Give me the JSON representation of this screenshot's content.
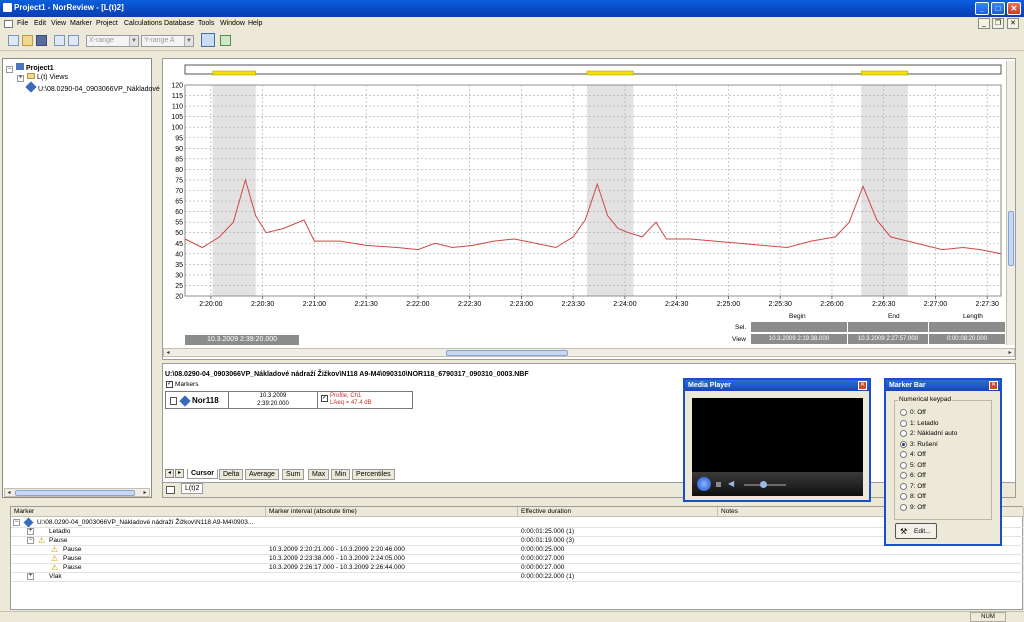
{
  "window": {
    "title": "Project1 - NorReview - [L(t)2]",
    "minimize": "_",
    "maximize": "□",
    "close": "✕",
    "mdi_minimize": "_",
    "mdi_restore": "❐",
    "mdi_close": "✕"
  },
  "menu": [
    "File",
    "Edit",
    "View",
    "Marker",
    "Project",
    "Calculations",
    "Database",
    "Tools",
    "Window",
    "Help"
  ],
  "toolbar": {
    "xrange_placeholder": "X-range",
    "yrange_placeholder": "Y-range A"
  },
  "tree": {
    "root": "Project1",
    "child1": "L(t) Views",
    "child2": "U:\\08.0290-04_0903066VP_Nákladové"
  },
  "chart_data": {
    "type": "line",
    "series": [
      {
        "name": "Profile, Ch1",
        "color": "#d04848",
        "values": []
      }
    ],
    "x_ticks": [
      "2:20:00",
      "2:20:30",
      "2:21:00",
      "2:21:30",
      "2:22:00",
      "2:22:30",
      "2:23:00",
      "2:23:30",
      "2:24:00",
      "2:24:30",
      "2:25:00",
      "2:25:30",
      "2:26:00",
      "2:26:30",
      "2:27:00",
      "2:27:30"
    ],
    "y_ticks": [
      120,
      115,
      110,
      105,
      100,
      95,
      90,
      85,
      80,
      75,
      70,
      65,
      60,
      55,
      50,
      45,
      40,
      35,
      30,
      25,
      20
    ],
    "ylim": [
      20,
      120
    ],
    "xlim_seconds": [
      1185,
      1658
    ],
    "grid": true,
    "shaded_intervals_seconds": [
      [
        1201,
        1226
      ],
      [
        1418,
        1445
      ],
      [
        1577,
        1604
      ]
    ],
    "profile_points": [
      [
        1185,
        47
      ],
      [
        1195,
        43
      ],
      [
        1205,
        48
      ],
      [
        1213,
        55
      ],
      [
        1220,
        75
      ],
      [
        1226,
        58
      ],
      [
        1232,
        50
      ],
      [
        1242,
        52
      ],
      [
        1254,
        56
      ],
      [
        1260,
        46
      ],
      [
        1275,
        46
      ],
      [
        1290,
        44
      ],
      [
        1308,
        43
      ],
      [
        1320,
        42
      ],
      [
        1330,
        45
      ],
      [
        1340,
        43
      ],
      [
        1352,
        44
      ],
      [
        1364,
        46
      ],
      [
        1376,
        47
      ],
      [
        1388,
        45
      ],
      [
        1400,
        43
      ],
      [
        1410,
        48
      ],
      [
        1417,
        56
      ],
      [
        1424,
        73
      ],
      [
        1430,
        58
      ],
      [
        1436,
        52
      ],
      [
        1442,
        50
      ],
      [
        1450,
        48
      ],
      [
        1458,
        55
      ],
      [
        1464,
        47
      ],
      [
        1478,
        47
      ],
      [
        1492,
        46
      ],
      [
        1506,
        45
      ],
      [
        1520,
        44
      ],
      [
        1534,
        43
      ],
      [
        1548,
        46
      ],
      [
        1562,
        48
      ],
      [
        1570,
        55
      ],
      [
        1578,
        72
      ],
      [
        1586,
        56
      ],
      [
        1594,
        48
      ],
      [
        1604,
        46
      ],
      [
        1614,
        44
      ],
      [
        1624,
        42
      ],
      [
        1636,
        43
      ],
      [
        1646,
        42
      ],
      [
        1658,
        40
      ]
    ]
  },
  "chart": {
    "cursor_time": "10.3.2009 2:39:20.000",
    "sel_label": "Sel.",
    "view_label": "View",
    "begin_label": "Begin",
    "end_label": "End",
    "length_label": "Length",
    "view_begin": "10.3.2009 2:19:38.000",
    "view_end": "10.3.2009 2:27:57.000",
    "view_length": "0:00:08:20.000"
  },
  "info": {
    "file_path": "U:\\08.0290-04_0903066VP_Nákladové nádraží Žižkov\\N118 A9-M4\\090310\\NOR118_6790317_090310_0003.NBF",
    "markers_label": "Markers",
    "device": "Nor118",
    "date": "10.3.2009",
    "time": "2:39:20.000",
    "profile_label": "Profile, Ch1",
    "profile_value": "LAeq = 47.4 dB",
    "tabs": [
      "Cursor",
      "Delta",
      "Average",
      "Sum",
      "Max",
      "Min",
      "Percentiles"
    ],
    "doc_tab": "L(t)2"
  },
  "media_player": {
    "title": "Media Player"
  },
  "marker_bar": {
    "title": "Marker Bar",
    "group": "Numerical keypad",
    "options": [
      "0: Off",
      "1: Letadlo",
      "2: Nákladní auto",
      "3: Rušení",
      "4: Off",
      "5: Off",
      "6: Off",
      "7: Off",
      "8: Off",
      "9: Off"
    ],
    "selected": 3,
    "edit_label": "Edit..."
  },
  "table": {
    "headers": [
      "Marker",
      "Marker interval (absolute time)",
      "Effective duration",
      "Notes"
    ],
    "rows": [
      {
        "marker": "U:\\08.0290-04_0903066VP_Nákladové nádraží Žižkov\\N118 A9-M4\\0903...",
        "interval": "",
        "duration": ""
      },
      {
        "marker": "Letadlo",
        "interval": "",
        "duration": "0:00:01:25.000 (1)"
      },
      {
        "marker": "Pause",
        "interval": "",
        "duration": "0:00:01:19.000 (3)"
      },
      {
        "marker": "Pause",
        "interval": "10.3.2009 2:20:21.000 - 10.3.2009 2:20:46.000",
        "duration": "0:00:00:25.000"
      },
      {
        "marker": "Pause",
        "interval": "10.3.2009 2:23:38.000 - 10.3.2009 2:24:05.000",
        "duration": "0:00:00:27.000"
      },
      {
        "marker": "Pause",
        "interval": "10.3.2009 2:26:17.000 - 10.3.2009 2:26:44.000",
        "duration": "0:00:00:27.000"
      },
      {
        "marker": "Vlak",
        "interval": "",
        "duration": "0:00:00:22.000 (1)"
      }
    ]
  },
  "status": {
    "num": "NUM"
  }
}
